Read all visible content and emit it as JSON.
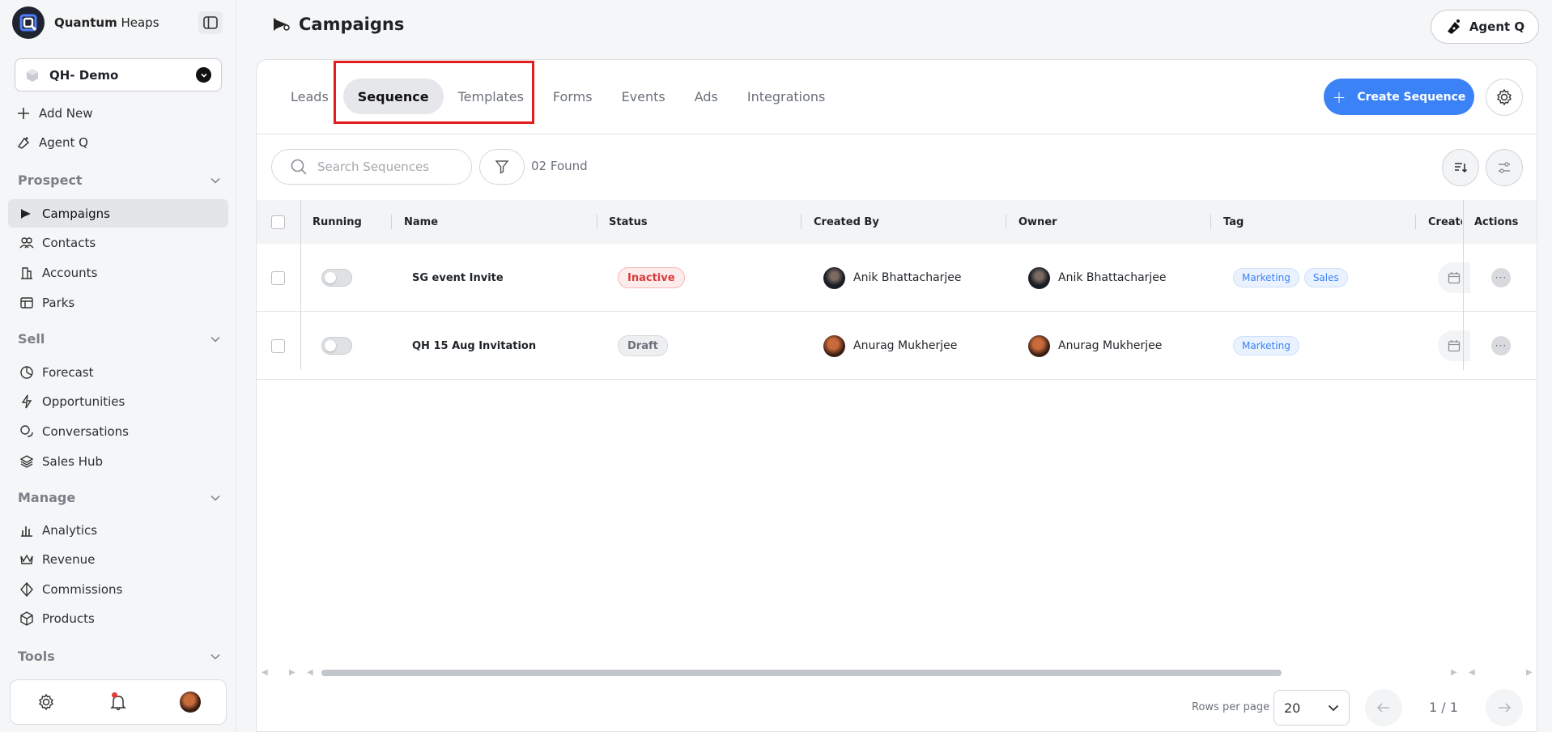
{
  "brand": {
    "name_bold": "Quantum",
    "name_rest": " Heaps"
  },
  "workspace": {
    "label": "QH- Demo"
  },
  "quick_actions": [
    {
      "label": "Add New",
      "icon": "plus-icon"
    },
    {
      "label": "Agent Q",
      "icon": "agent-icon"
    }
  ],
  "sections": {
    "prospect": "Prospect",
    "sell": "Sell",
    "manage": "Manage",
    "tools": "Tools"
  },
  "nav": {
    "campaigns": "Campaigns",
    "contacts": "Contacts",
    "accounts": "Accounts",
    "parks": "Parks",
    "forecast": "Forecast",
    "opportunities": "Opportunities",
    "conversations": "Conversations",
    "sales_hub": "Sales Hub",
    "analytics": "Analytics",
    "revenue": "Revenue",
    "commissions": "Commissions",
    "products": "Products"
  },
  "header": {
    "title": "Campaigns",
    "agent_button": "Agent Q"
  },
  "tabs": [
    "Leads",
    "Sequence",
    "Templates",
    "Forms",
    "Events",
    "Ads",
    "Integrations"
  ],
  "active_tab": "Sequence",
  "toolbar": {
    "create_label": "Create Sequence",
    "search_placeholder": "Search Sequences",
    "found_text": "02 Found"
  },
  "table": {
    "columns": [
      "Running",
      "Name",
      "Status",
      "Created By",
      "Owner",
      "Tag",
      "Create",
      "Actions"
    ],
    "rows": [
      {
        "name": "SG event Invite",
        "status": "Inactive",
        "created_by": "Anik Bhattacharjee",
        "owner": "Anik Bhattacharjee",
        "tags": [
          "Marketing",
          "Sales"
        ]
      },
      {
        "name": "QH 15 Aug Invitation",
        "status": "Draft",
        "created_by": "Anurag Mukherjee",
        "owner": "Anurag Mukherjee",
        "tags": [
          "Marketing"
        ]
      }
    ]
  },
  "pagination": {
    "rows_label": "Rows per page",
    "rows_value": "20",
    "page_text": "1 / 1"
  },
  "colors": {
    "accent": "#3b82f6",
    "highlight": "#e11d1d",
    "inactive": "#d93a3a"
  }
}
